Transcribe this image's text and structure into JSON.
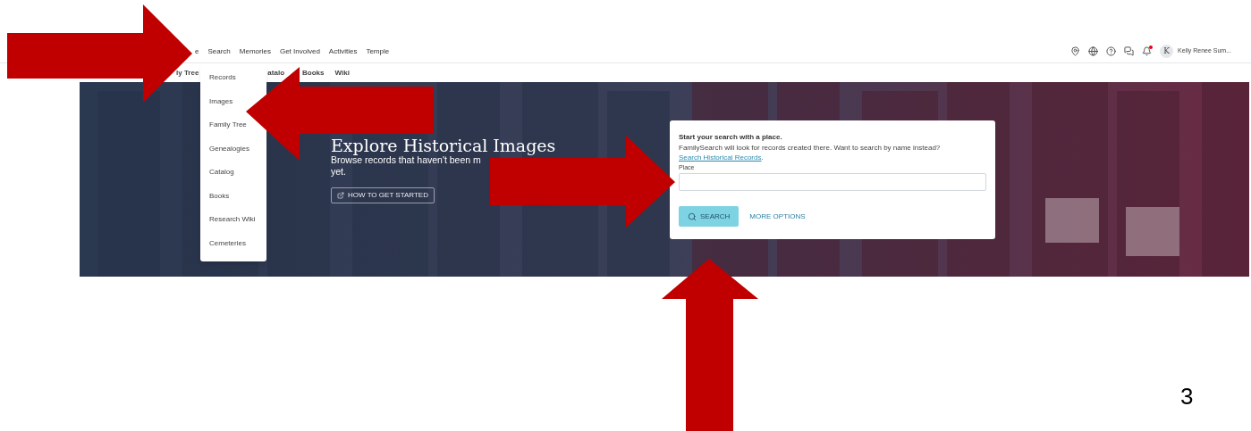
{
  "nav": {
    "primary": [
      "e",
      "Search",
      "Memories",
      "Get Involved",
      "Activities",
      "Temple"
    ],
    "secondary": [
      "ly Tree",
      "atalo",
      "Books",
      "Wiki"
    ]
  },
  "account": {
    "has_notification": true,
    "initial": "K",
    "name": "Kelly Renee Sum..."
  },
  "dropdown": {
    "items": [
      "Records",
      "Images",
      "Family Tree",
      "Genealogies",
      "Catalog",
      "Books",
      "Research Wiki",
      "Cemeteries"
    ]
  },
  "hero": {
    "title": "Explore Historical Images",
    "subtitle_lines": [
      "Browse records that haven't been m",
      "yet."
    ],
    "button": "HOW TO GET STARTED"
  },
  "search_card": {
    "heading": "Start your search with a place.",
    "text": "FamilySearch will look for records created there. Want to search by name instead?",
    "link": "Search Historical Records",
    "text_end": ".",
    "field_label": "Place",
    "search_button": "SEARCH",
    "more_options": "MORE OPTIONS"
  },
  "slide_number": "3"
}
